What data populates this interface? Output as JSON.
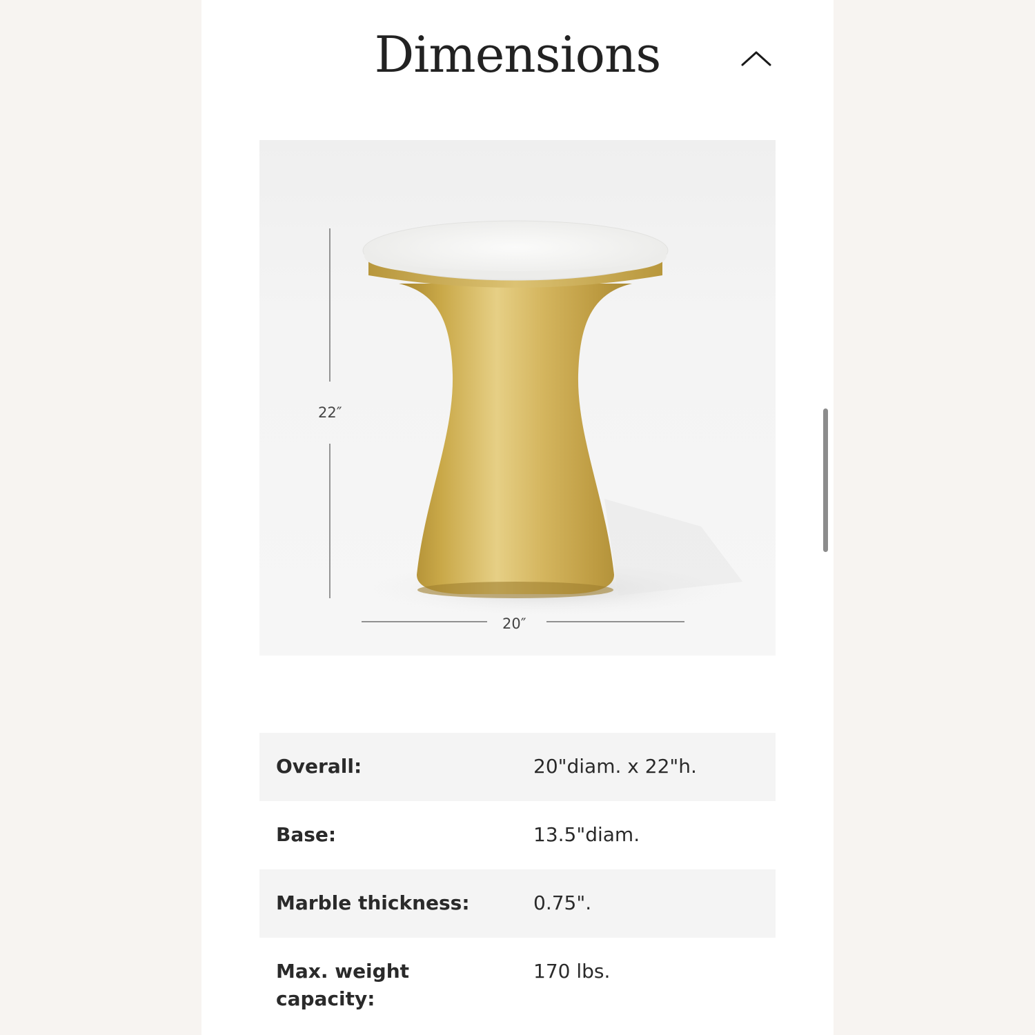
{
  "section": {
    "title": "Dimensions",
    "collapse_icon": "chevron-up-icon"
  },
  "product_image": {
    "height_label": "22″",
    "width_label": "20″",
    "colors": {
      "marble": "#f4f4f2",
      "brass": "#c9a84a",
      "background": "#f3f3f3"
    }
  },
  "specs": [
    {
      "label": "Overall:",
      "value": "20\"diam. x 22\"h."
    },
    {
      "label": "Base:",
      "value": "13.5\"diam."
    },
    {
      "label": "Marble thickness:",
      "value": "0.75\"."
    },
    {
      "label": "Max. weight capacity:",
      "value": "170 lbs."
    }
  ]
}
